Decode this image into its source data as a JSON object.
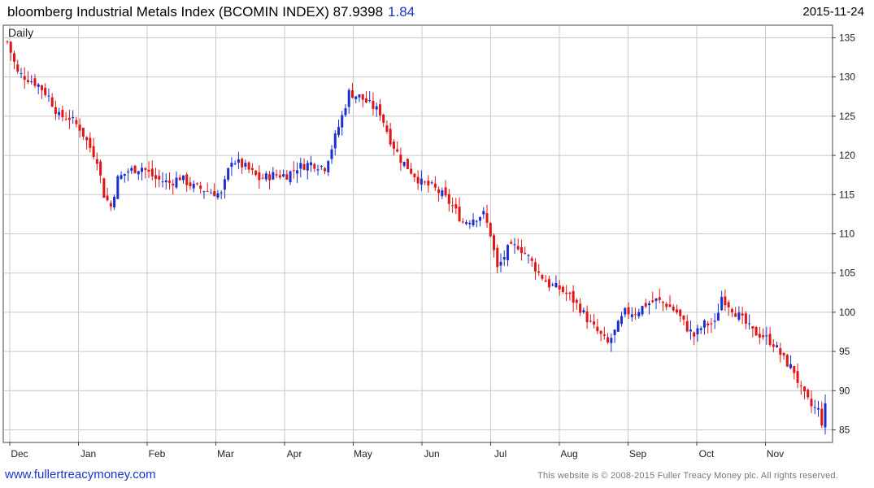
{
  "header": {
    "title": "bloomberg Industrial Metals Index (BCOMIN INDEX) 87.9398",
    "change": "1.84",
    "date": "2015-11-24"
  },
  "footer": {
    "site": "www.fullertreacymoney.com",
    "copyright": "This website is © 2008-2015 Fuller Treacy Money plc. All rights reserved."
  },
  "colors": {
    "up": "#1a2fd0",
    "down": "#e01616",
    "grid": "#c8c8c8"
  },
  "chart_data": {
    "type": "candlestick",
    "timeframe_label": "Daily",
    "x_ticks": [
      "Dec",
      "Jan",
      "Feb",
      "Mar",
      "Apr",
      "May",
      "Jun",
      "Jul",
      "Aug",
      "Sep",
      "Oct",
      "Nov"
    ],
    "y_ticks": [
      85,
      90,
      95,
      100,
      105,
      110,
      115,
      120,
      125,
      130,
      135
    ],
    "ylim": [
      83.5,
      136.5
    ],
    "grid": true,
    "close_path_approx": [
      [
        0,
        134.5
      ],
      [
        6,
        130.5
      ],
      [
        12,
        129.8
      ],
      [
        18,
        129
      ],
      [
        24,
        127.5
      ],
      [
        30,
        125
      ],
      [
        36,
        124.8
      ],
      [
        42,
        123.5
      ],
      [
        48,
        121
      ],
      [
        52,
        119.5
      ],
      [
        56,
        115
      ],
      [
        60,
        113.5
      ],
      [
        64,
        117
      ],
      [
        70,
        118
      ],
      [
        78,
        118.5
      ],
      [
        86,
        117
      ],
      [
        94,
        116.5
      ],
      [
        100,
        117.2
      ],
      [
        108,
        116
      ],
      [
        116,
        115.5
      ],
      [
        124,
        115
      ],
      [
        130,
        119.5
      ],
      [
        138,
        118.5
      ],
      [
        146,
        117
      ],
      [
        154,
        117.5
      ],
      [
        162,
        117.5
      ],
      [
        168,
        118.5
      ],
      [
        176,
        119
      ],
      [
        184,
        118.5
      ],
      [
        188,
        121
      ],
      [
        194,
        125
      ],
      [
        198,
        128
      ],
      [
        204,
        127.5
      ],
      [
        210,
        126.5
      ],
      [
        216,
        125.5
      ],
      [
        222,
        122
      ],
      [
        228,
        119.5
      ],
      [
        234,
        118
      ],
      [
        240,
        116.5
      ],
      [
        246,
        116
      ],
      [
        252,
        115
      ],
      [
        258,
        113.5
      ],
      [
        264,
        111.5
      ],
      [
        270,
        112
      ],
      [
        276,
        112.5
      ],
      [
        280,
        110
      ],
      [
        284,
        105.5
      ],
      [
        290,
        108
      ],
      [
        296,
        108.5
      ],
      [
        302,
        107
      ],
      [
        308,
        105
      ],
      [
        314,
        103.5
      ],
      [
        320,
        103
      ],
      [
        326,
        102
      ],
      [
        332,
        100.5
      ],
      [
        338,
        98.5
      ],
      [
        342,
        97.5
      ],
      [
        348,
        96
      ],
      [
        352,
        97.5
      ],
      [
        358,
        100
      ],
      [
        364,
        100
      ],
      [
        370,
        101
      ],
      [
        376,
        101.5
      ],
      [
        382,
        101
      ],
      [
        388,
        100
      ],
      [
        394,
        98
      ],
      [
        398,
        97
      ],
      [
        404,
        98.5
      ],
      [
        410,
        98.5
      ],
      [
        414,
        102
      ],
      [
        420,
        100.5
      ],
      [
        426,
        99
      ],
      [
        432,
        97.5
      ],
      [
        438,
        97
      ],
      [
        444,
        96
      ],
      [
        450,
        94
      ],
      [
        456,
        92.5
      ],
      [
        460,
        90
      ],
      [
        466,
        88
      ],
      [
        470,
        87.5
      ],
      [
        472,
        86
      ],
      [
        474,
        87.9
      ]
    ],
    "n_days": 475
  }
}
